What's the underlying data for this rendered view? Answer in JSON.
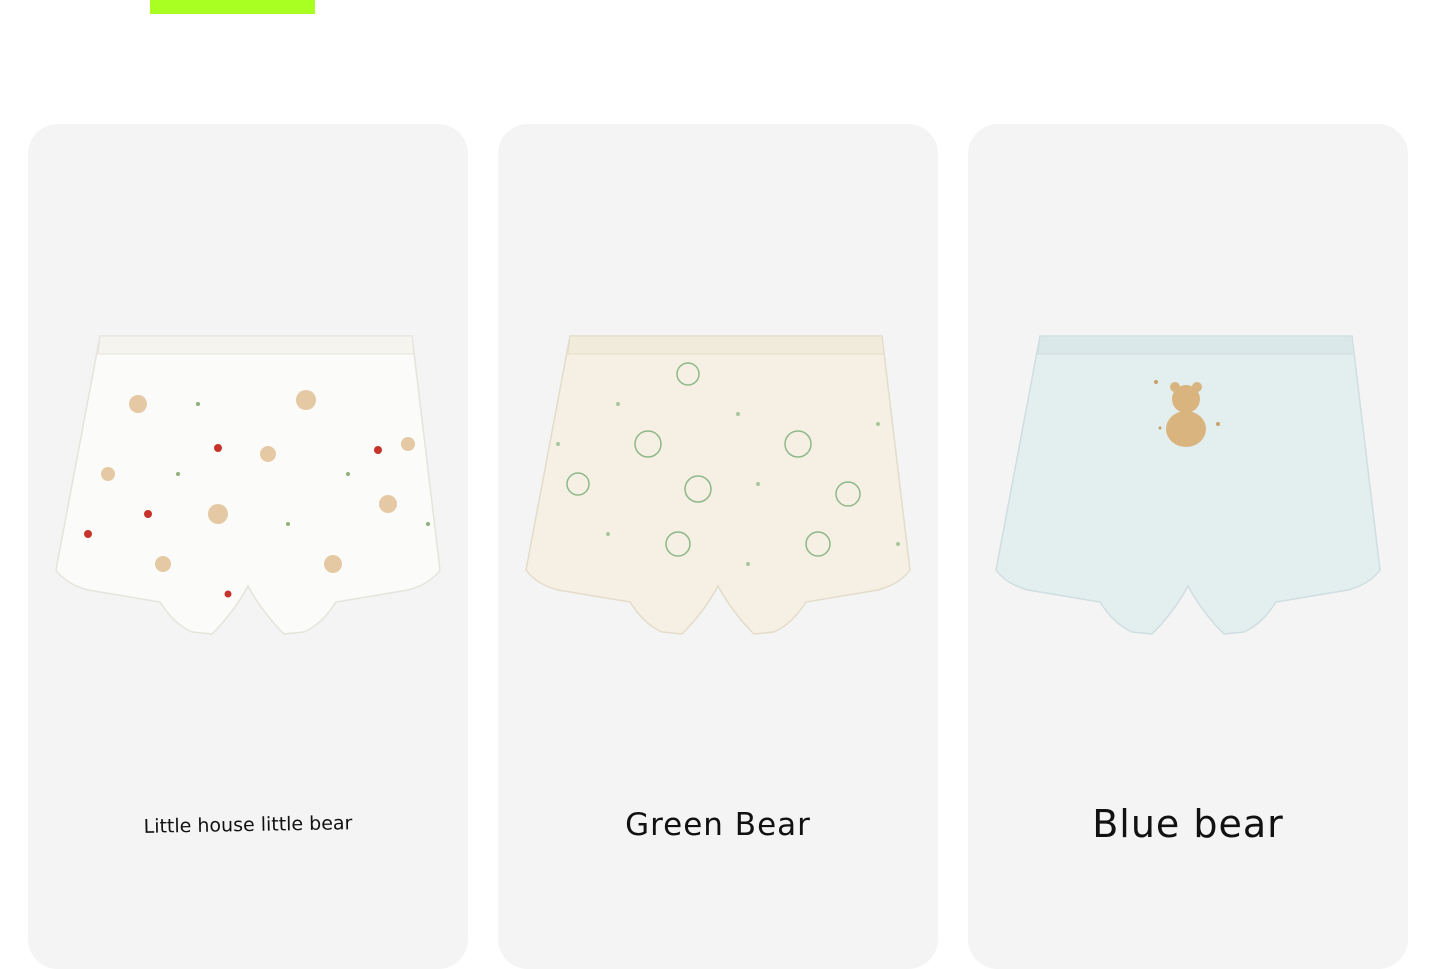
{
  "header": {
    "accent_color": "#aaff22"
  },
  "products": [
    {
      "label": "Little house little bear",
      "fabric_color": "#fbfbf9",
      "print": "bears-houses-flowers"
    },
    {
      "label": "Green Bear",
      "fabric_color": "#f5f0e3",
      "print": "green-bears-dots"
    },
    {
      "label": "Blue bear",
      "fabric_color": "#e3eeef",
      "print": "single-bear-motif"
    }
  ]
}
